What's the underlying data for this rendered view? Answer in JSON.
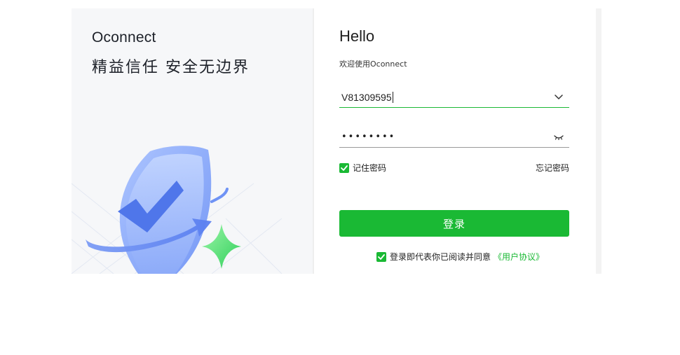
{
  "brand": {
    "name": "Oconnect",
    "slogan": "精益信任 安全无边界"
  },
  "form": {
    "title": "Hello",
    "subtitle": "欢迎使用Oconnect",
    "username_value": "V81309595",
    "password_value": "••••••••",
    "remember_label": "记住密码",
    "remember_checked": true,
    "forgot_label": "忘记密码",
    "login_label": "登录",
    "agreement_text": "登录即代表你已阅读并同意",
    "agreement_link": "《用户协议》",
    "agreement_checked": true
  },
  "colors": {
    "accent": "#1ab934",
    "panel_bg": "#f6f7f9",
    "shield": "#8fb0fb",
    "star": "#4fe07a"
  },
  "icons": {
    "username_dropdown": "chevron-down-icon",
    "password_toggle": "eye-closed-icon",
    "checkbox": "check-icon"
  }
}
